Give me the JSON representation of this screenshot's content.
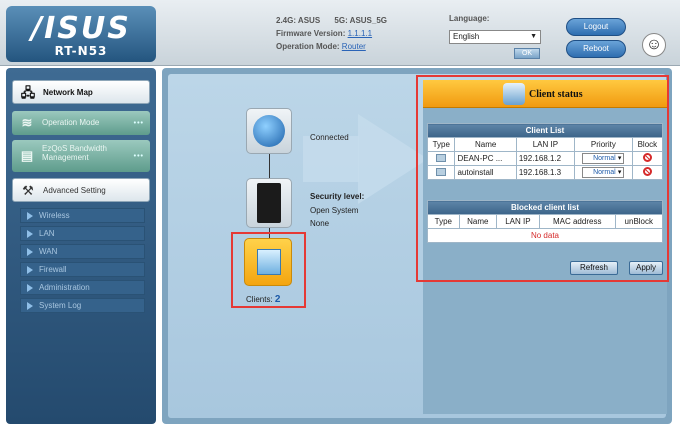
{
  "header": {
    "logo": "/ISUS",
    "model": "RT-N53",
    "ssid_24": "2.4G: ASUS",
    "ssid_5": "5G: ASUS_5G",
    "firmware_label": "Firmware Version:",
    "firmware_value": "1.1.1.1",
    "opmode_label": "Operation Mode:",
    "opmode_value": "Router",
    "language_label": "Language:",
    "language_value": "English",
    "ok_label": "OK",
    "logout_label": "Logout",
    "reboot_label": "Reboot"
  },
  "sidebar": {
    "network_map": "Network Map",
    "operation_mode": "Operation Mode",
    "ezqos": "EzQoS Bandwidth Management",
    "advanced_setting": "Advanced Setting",
    "items": [
      {
        "label": "Wireless"
      },
      {
        "label": "LAN"
      },
      {
        "label": "WAN"
      },
      {
        "label": "Firewall"
      },
      {
        "label": "Administration"
      },
      {
        "label": "System Log"
      }
    ]
  },
  "map": {
    "connected": "Connected",
    "security_label": "Security level:",
    "security_mode": "Open System",
    "security_enc": "None",
    "clients_label": "Clients:",
    "clients_count": "2"
  },
  "client_status": {
    "title": "Client status",
    "client_list_caption": "Client List",
    "columns": [
      "Type",
      "Name",
      "LAN IP",
      "Priority",
      "Block"
    ],
    "rows": [
      {
        "name": "DEAN-PC ...",
        "ip": "192.168.1.2",
        "priority": "Normal"
      },
      {
        "name": "autoinstall",
        "ip": "192.168.1.3",
        "priority": "Normal"
      }
    ],
    "blocked_caption": "Blocked client list",
    "blocked_columns": [
      "Type",
      "Name",
      "LAN IP",
      "MAC address",
      "unBlock"
    ],
    "no_data": "No data",
    "refresh_label": "Refresh",
    "apply_label": "Apply"
  }
}
